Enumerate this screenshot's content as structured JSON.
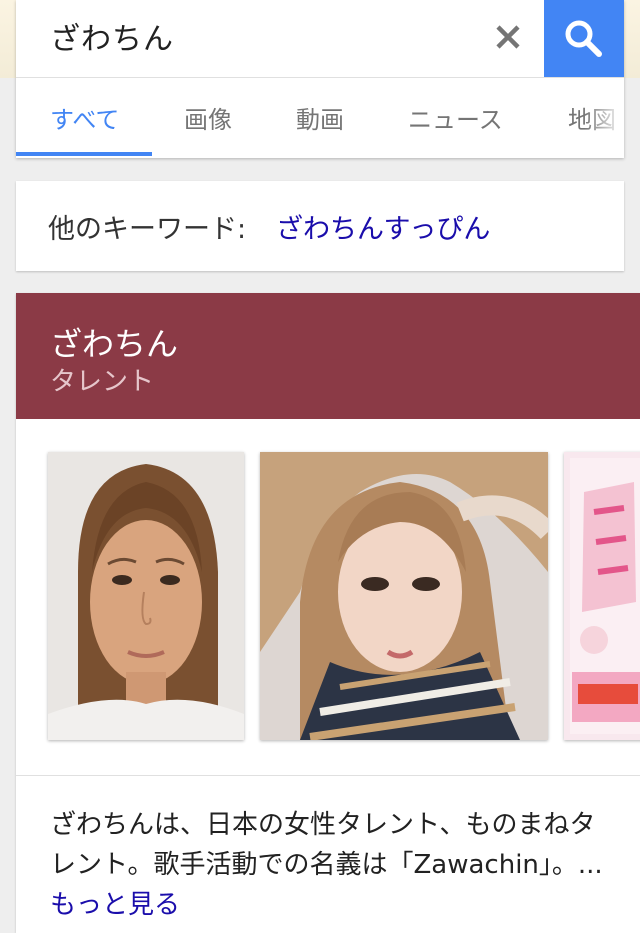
{
  "search": {
    "query": "ざわちん"
  },
  "tabs": [
    {
      "label": "すべて",
      "active": true
    },
    {
      "label": "画像"
    },
    {
      "label": "動画"
    },
    {
      "label": "ニュース"
    },
    {
      "label": "地図"
    }
  ],
  "keywords": {
    "label": "他のキーワード:",
    "link": "ざわちんすっぴん"
  },
  "knowledge": {
    "title": "ざわちん",
    "subtitle": "タレント",
    "description": "ざわちんは、日本の女性タレント、ものまねタレント。歌手活動での名義は「Zawachin」。...",
    "more_link": "もっと見る"
  },
  "images": [
    {
      "name": "photo-bare-face"
    },
    {
      "name": "photo-makeup"
    },
    {
      "name": "photo-book-cover"
    }
  ],
  "colors": {
    "accent": "#4285f4",
    "header": "#8b3a46",
    "link": "#1a0dab"
  }
}
